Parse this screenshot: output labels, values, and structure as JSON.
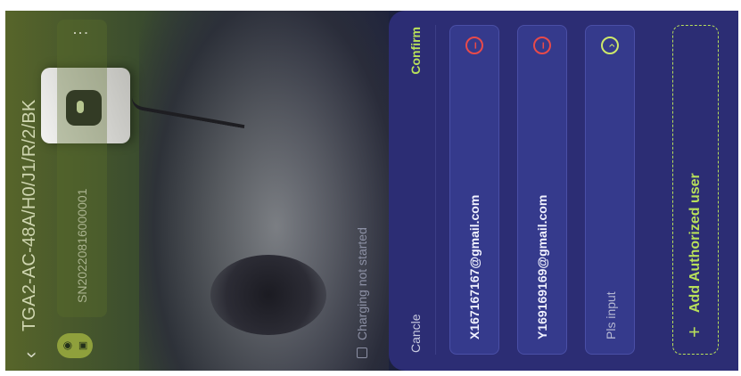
{
  "device": {
    "model": "TGA2-AC-48A/H0/J1/R/2/BK",
    "serial": "SN20220816000001",
    "status": "Charging not started"
  },
  "icons": {
    "back": "chevron-left-icon",
    "wifi": "wifi-icon",
    "lock": "lock-icon",
    "more": "more-icon",
    "plug": "plug-icon",
    "remove": "remove-icon",
    "arrow": "arrow-icon",
    "plus": "plus-icon"
  },
  "sheet": {
    "cancel_label": "Cancle",
    "confirm_label": "Confirm",
    "users": [
      {
        "email": "X167167167@gmail.com"
      },
      {
        "email": "Y169169169@gmail.com"
      }
    ],
    "input_placeholder": "Pls input",
    "add_label": "Add Authorized user"
  },
  "colors": {
    "accent": "#b8e05a",
    "danger": "#e84a4a",
    "sheet_bg": "#2c2d74"
  }
}
